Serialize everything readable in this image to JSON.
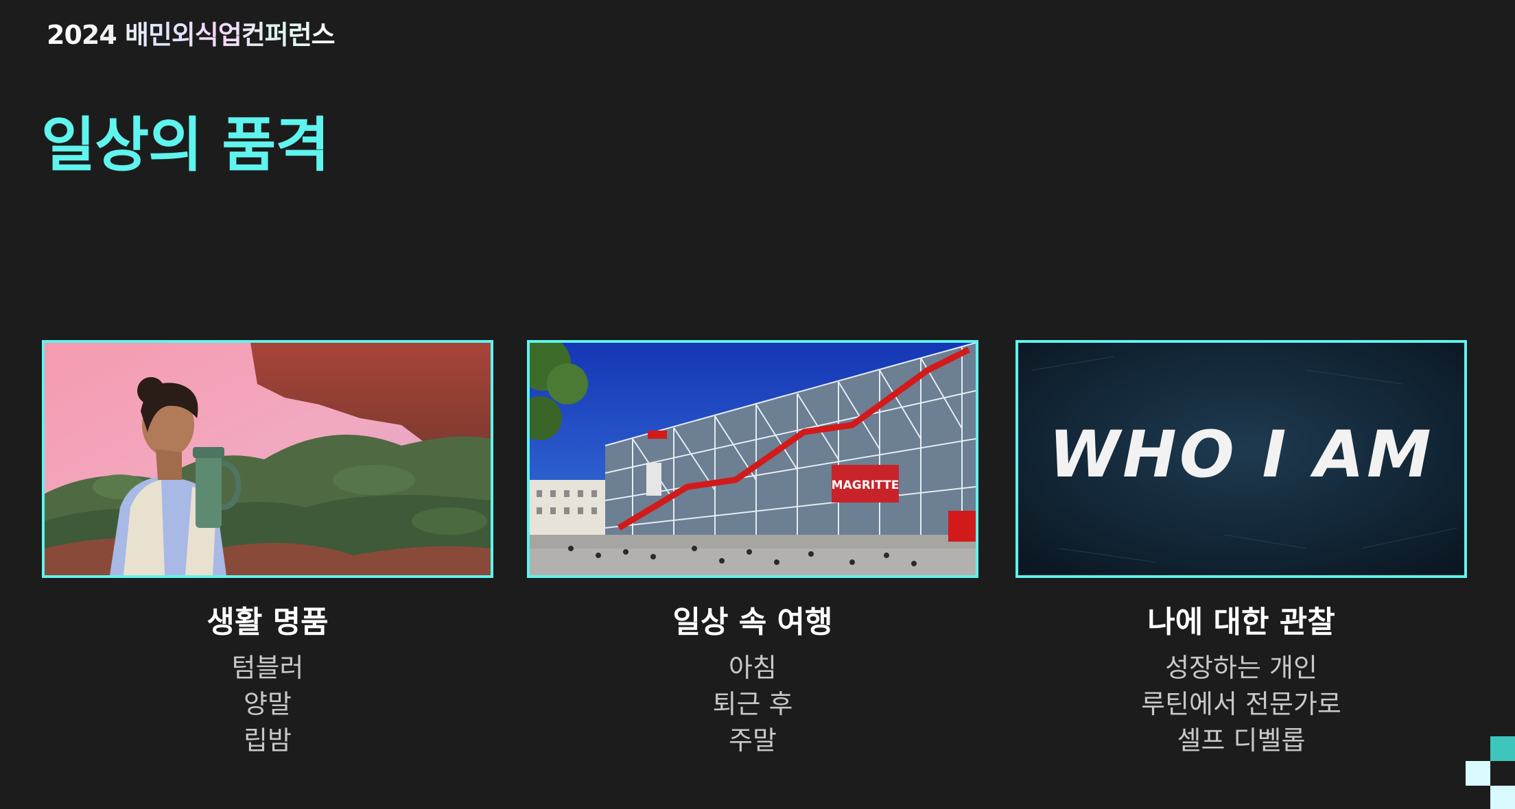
{
  "logo": "2024 배민외식업컨퍼런스",
  "title": "일상의 품격",
  "colors": {
    "background": "#1c1c1c",
    "accent": "#5ff4ee",
    "text_primary": "#ffffff",
    "text_secondary": "#c8c8c8"
  },
  "columns": [
    {
      "image": "woman-with-tumbler-photo",
      "title": "생활 명품",
      "items": [
        "텀블러",
        "양말",
        "립밤"
      ]
    },
    {
      "image": "pompidou-centre-photo",
      "title": "일상 속 여행",
      "items": [
        "아침",
        "퇴근 후",
        "주말"
      ]
    },
    {
      "image": "who-i-am-chalkboard-image",
      "image_text": "WHO I AM",
      "title": "나에 대한 관찰",
      "items": [
        "성장하는 개인",
        "루틴에서 전문가로",
        "셀프 디벨롭"
      ]
    }
  ],
  "photo_text": {
    "banner": "MAGRITTE"
  }
}
